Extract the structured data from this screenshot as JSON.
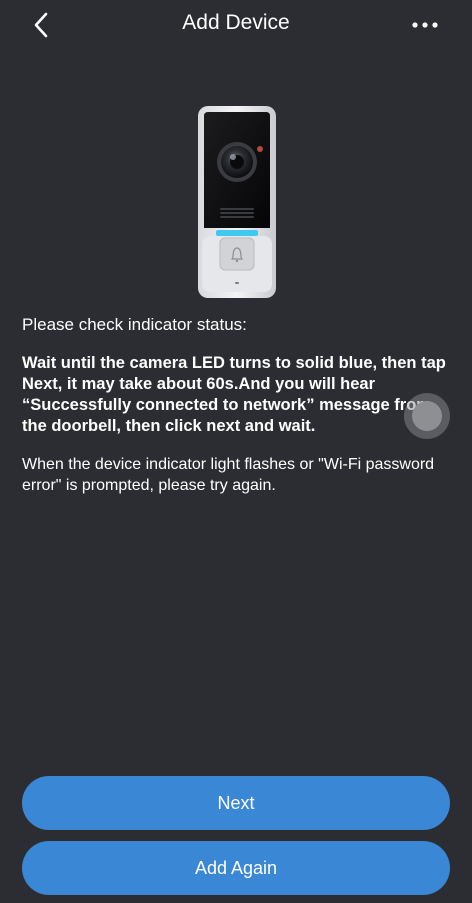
{
  "header": {
    "title": "Add Device",
    "back_icon": "chevron-left-icon",
    "more_icon": "more-horizontal-icon"
  },
  "device": {
    "image": "video-doorbell-illustration"
  },
  "content": {
    "status_heading": "Please check indicator status:",
    "instruction": "Wait until the camera LED turns to solid blue, then tap Next, it may take about 60s.And you will hear “Successfully connected to network” message from the doorbell, then click next and wait.",
    "retry_note": "When the device indicator light flashes or \"Wi-Fi password error\" is prompted, please try again."
  },
  "buttons": {
    "next_label": "Next",
    "add_again_label": "Add Again"
  },
  "colors": {
    "background": "#2b2d32",
    "accent": "#3a87d6",
    "led": "#3fc8f0"
  }
}
